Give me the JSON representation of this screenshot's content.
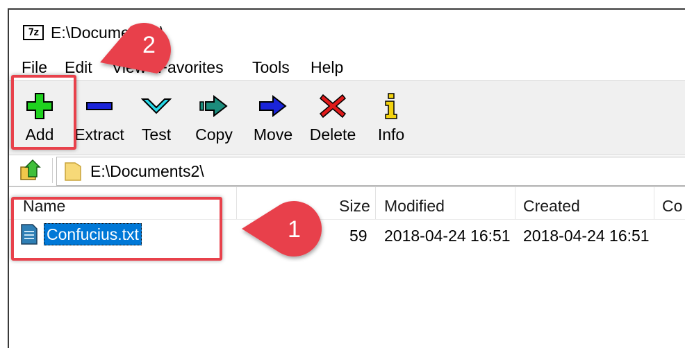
{
  "window": {
    "title": "E:\\Documents2\\"
  },
  "menu": [
    "File",
    "Edit",
    "View",
    "Favorites",
    "Tools",
    "Help"
  ],
  "toolbar": [
    {
      "label": "Add",
      "icon": "add-icon"
    },
    {
      "label": "Extract",
      "icon": "extract-icon"
    },
    {
      "label": "Test",
      "icon": "test-icon"
    },
    {
      "label": "Copy",
      "icon": "copy-icon"
    },
    {
      "label": "Move",
      "icon": "move-icon"
    },
    {
      "label": "Delete",
      "icon": "delete-icon"
    },
    {
      "label": "Info",
      "icon": "info-icon"
    }
  ],
  "address": {
    "path": "E:\\Documents2\\"
  },
  "columns": [
    "Name",
    "Size",
    "Modified",
    "Created",
    "Co"
  ],
  "files": [
    {
      "name": "Confucius.txt",
      "size": "59",
      "modified": "2018-04-24 16:51",
      "created": "2018-04-24 16:51"
    }
  ],
  "callouts": [
    {
      "number": "1"
    },
    {
      "number": "2"
    }
  ],
  "colors": {
    "highlight": "#e8414b",
    "selection": "#0078d7",
    "toolbar_bg": "#f0f0f0"
  }
}
